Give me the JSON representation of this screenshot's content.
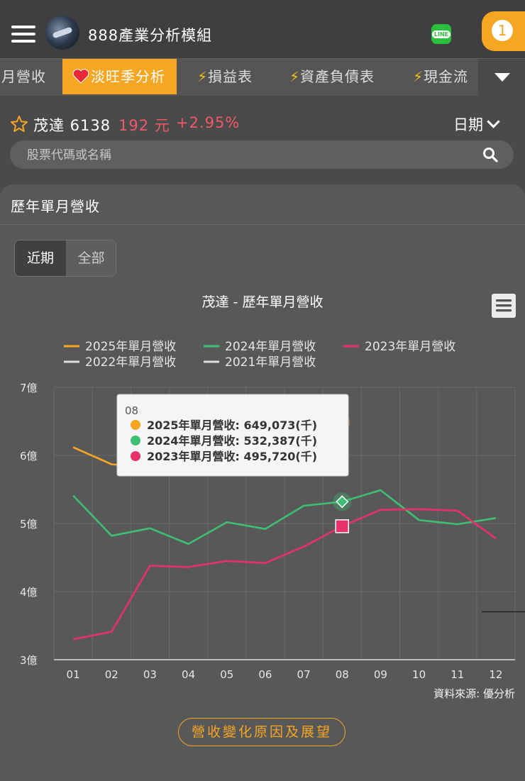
{
  "header": {
    "app_title": "888產業分析模組",
    "notification_count": "1",
    "line_label": "LINE"
  },
  "tabs": [
    {
      "label": "月營收"
    },
    {
      "label": "淡旺季分析",
      "icon": "heart-icon"
    },
    {
      "label": "損益表",
      "icon": "bolt-icon"
    },
    {
      "label": "資產負債表",
      "icon": "bolt-icon"
    },
    {
      "label": "現金流",
      "icon": "bolt-icon"
    }
  ],
  "stock": {
    "name_code": "茂達 6138",
    "price": "192 元",
    "change": "+2.95%",
    "date_label": "日期"
  },
  "search": {
    "placeholder": "股票代碼或名稱"
  },
  "card": {
    "title": "歷年單月營收",
    "period_options": [
      "近期",
      "全部"
    ],
    "selected_period": "近期",
    "outlook_button": "營收變化原因及展望"
  },
  "colors": {
    "accent": "#f5a623",
    "price_up": "#f0596a",
    "series_2025": "#f5a623",
    "series_2024": "#3fbf73",
    "series_2023": "#e8306a",
    "series_2022": "#e0e0e0",
    "series_2021": "#e0e0e0"
  },
  "chart_data": {
    "type": "line",
    "title": "茂達 - 歷年單月營收",
    "categories": [
      "01",
      "02",
      "03",
      "04",
      "05",
      "06",
      "07",
      "08",
      "09",
      "10",
      "11",
      "12"
    ],
    "y_ticks": [
      "7億",
      "6億",
      "5億",
      "4億",
      "3億"
    ],
    "ylim": [
      3,
      7
    ],
    "y_unit": "億",
    "legend_position": "top",
    "grid": true,
    "series": [
      {
        "name": "2025年單月營收",
        "values": [
          6.12,
          5.87,
          5.82,
          5.98,
          6.1,
          6.22,
          6.35,
          6.49,
          null,
          null,
          null,
          null
        ]
      },
      {
        "name": "2024年單月營收",
        "values": [
          5.41,
          4.82,
          4.93,
          4.7,
          5.02,
          4.92,
          5.26,
          5.32,
          5.49,
          5.05,
          4.99,
          5.08
        ]
      },
      {
        "name": "2023年單月營收",
        "values": [
          3.3,
          3.41,
          4.38,
          4.36,
          4.45,
          4.42,
          4.66,
          4.96,
          5.2,
          5.21,
          5.19,
          4.78
        ]
      },
      {
        "name": "2022年單月營收",
        "values": []
      },
      {
        "name": "2021年單月營收",
        "values": []
      }
    ],
    "tooltip": {
      "category": "08",
      "lines": [
        "2025年單月營收: 649,073(千)",
        "2024年單月營收: 532,387(千)",
        "2023年單月營收: 495,720(千)"
      ]
    },
    "source": "資料來源: 優分析"
  }
}
